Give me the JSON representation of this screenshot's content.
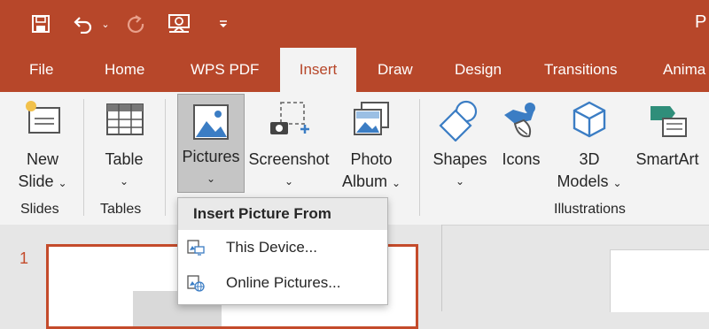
{
  "app": {
    "title_fragment": "P"
  },
  "quick_access": {
    "save": "save-icon",
    "undo": "undo-icon",
    "redo": "redo-icon",
    "present": "present-from-start-icon",
    "customize": "customize-qat-icon"
  },
  "tabs": [
    {
      "label": "File"
    },
    {
      "label": "Home"
    },
    {
      "label": "WPS PDF"
    },
    {
      "label": "Insert",
      "active": true
    },
    {
      "label": "Draw"
    },
    {
      "label": "Design"
    },
    {
      "label": "Transitions"
    },
    {
      "label": "Anima"
    }
  ],
  "ribbon": {
    "groups": {
      "slides": "Slides",
      "tables": "Tables",
      "illustrations": "Illustrations"
    },
    "buttons": {
      "new_slide_1": "New",
      "new_slide_2": "Slide",
      "table": "Table",
      "pictures": "Pictures",
      "screenshot": "Screenshot",
      "photo_album_1": "Photo",
      "photo_album_2": "Album",
      "shapes": "Shapes",
      "icons": "Icons",
      "models_1": "3D",
      "models_2": "Models",
      "smartart": "SmartArt"
    }
  },
  "dropdown": {
    "header": "Insert Picture From",
    "items": [
      {
        "label": "This Device...",
        "icon": "this-device-icon"
      },
      {
        "label": "Online Pictures...",
        "icon": "online-pictures-icon"
      }
    ]
  },
  "thumbnails": {
    "slide_number": "1"
  },
  "colors": {
    "accent": "#b7472a",
    "ribbon_bg": "#f3f3f3",
    "selected_bg": "#c5c5c5"
  }
}
